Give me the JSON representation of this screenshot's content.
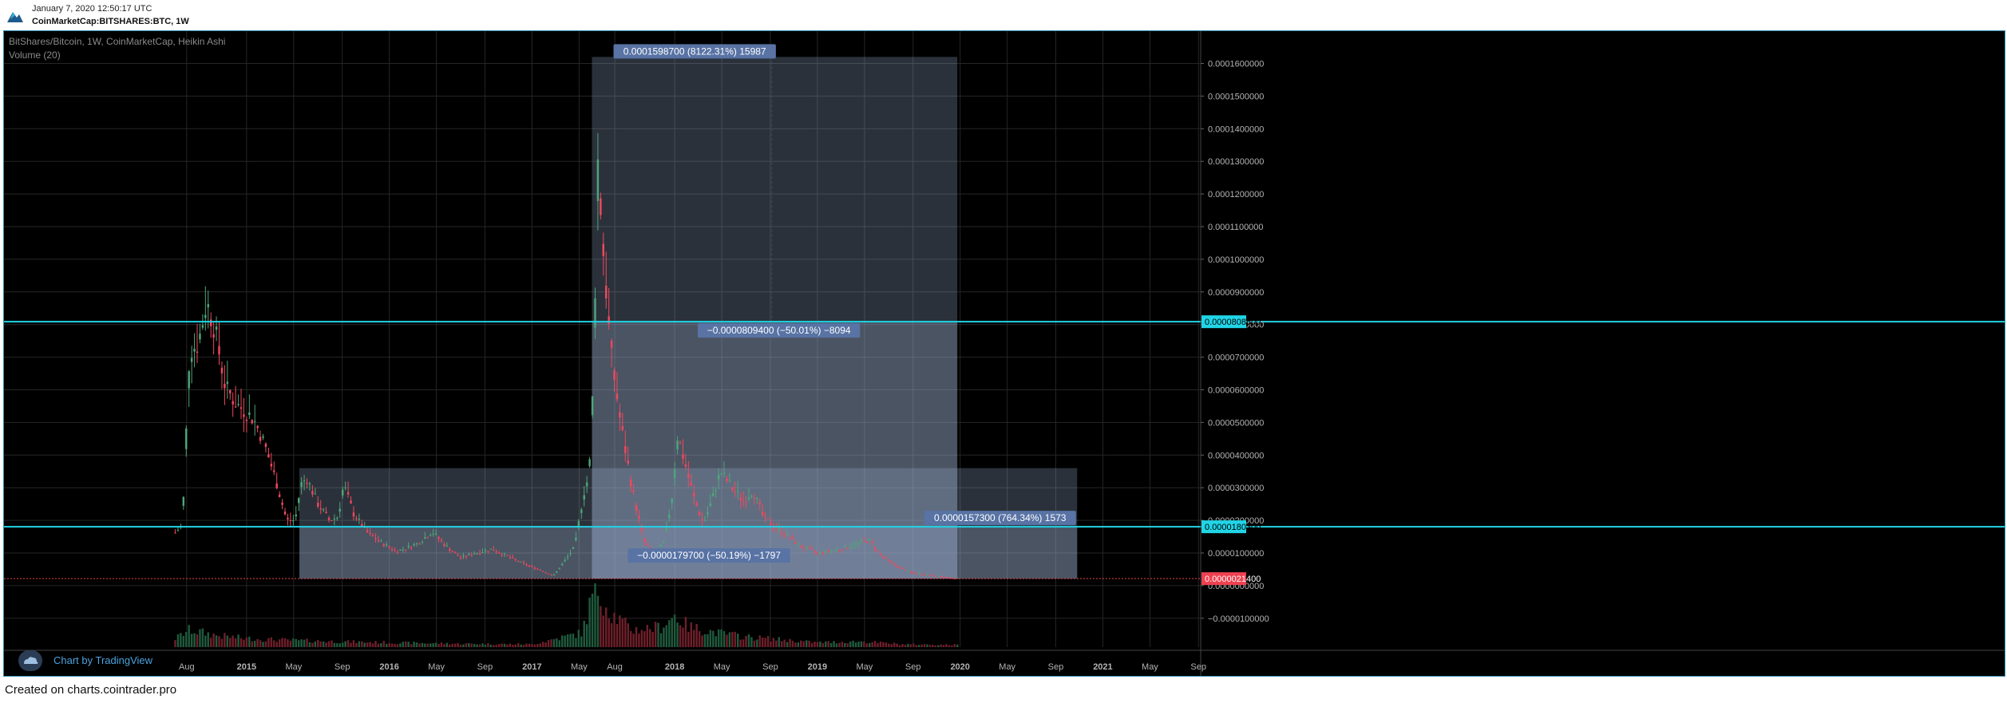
{
  "header": {
    "timestamp": "January 7, 2020 12:50:17 UTC",
    "symbol_line": "CoinMarketCap:BITSHARES:BTC, 1W"
  },
  "legend": {
    "title": "BitShares/Bitcoin, 1W, CoinMarketCap, Heikin Ashi",
    "volume": "Volume (20)"
  },
  "branding": "Chart by TradingView",
  "footer": "Created on charts.cointrader.pro",
  "colors": {
    "background": "#000000",
    "up": "#4ea67a",
    "down": "#f0485f",
    "hline": "#20d5e6",
    "box_fill": "#9cb0d0",
    "label_bg": "#5873a4",
    "last_price": "#ef4150"
  },
  "chart_data": {
    "type": "candlestick",
    "title": "BitShares/Bitcoin, 1W, CoinMarketCap, Heikin Ashi",
    "yaxis": {
      "ticks": [
        "0.0001600000",
        "0.0001500000",
        "0.0001400000",
        "0.0001300000",
        "0.0001200000",
        "0.0001100000",
        "0.0001000000",
        "0.0000900000",
        "0.0000800000",
        "0.0000700000",
        "0.0000600000",
        "0.0000500000",
        "0.0000400000",
        "0.0000300000",
        "0.0000200000",
        "0.0000100000",
        "0.0000000000",
        "−0.0000100000"
      ],
      "ylim": [
        -2.1e-05,
        0.0001665
      ]
    },
    "xaxis": {
      "ticks": [
        {
          "label": "Aug",
          "t": 2014.58
        },
        {
          "label": "2015",
          "t": 2015.0
        },
        {
          "label": "May",
          "t": 2015.33
        },
        {
          "label": "Sep",
          "t": 2015.67
        },
        {
          "label": "2016",
          "t": 2016.0
        },
        {
          "label": "May",
          "t": 2016.33
        },
        {
          "label": "Sep",
          "t": 2016.67
        },
        {
          "label": "2017",
          "t": 2017.0
        },
        {
          "label": "May",
          "t": 2017.33
        },
        {
          "label": "Aug",
          "t": 2017.58
        },
        {
          "label": "2018",
          "t": 2018.0
        },
        {
          "label": "May",
          "t": 2018.33
        },
        {
          "label": "Sep",
          "t": 2018.67
        },
        {
          "label": "2019",
          "t": 2019.0
        },
        {
          "label": "May",
          "t": 2019.33
        },
        {
          "label": "Sep",
          "t": 2019.67
        },
        {
          "label": "2020",
          "t": 2020.0
        },
        {
          "label": "May",
          "t": 2020.33
        },
        {
          "label": "Sep",
          "t": 2020.67
        },
        {
          "label": "2021",
          "t": 2021.0
        },
        {
          "label": "May",
          "t": 2021.33
        },
        {
          "label": "Sep",
          "t": 2021.67
        }
      ],
      "range": [
        2013.3,
        2021.68
      ]
    },
    "horizontal_lines": [
      {
        "price": 8.086e-05,
        "label": "0.0000808600"
      },
      {
        "price": 1.803e-05,
        "label": "0.0000180300"
      }
    ],
    "last_price": {
      "price": 2.14e-06,
      "label": "0.0000021400"
    },
    "measures": [
      {
        "t0": 2017.42,
        "t1": 2019.98,
        "p0": 2.14e-06,
        "p1": 0.000162,
        "label": "0.0001598700 (8122.31%) 15987"
      },
      {
        "t0": 2017.42,
        "t1": 2019.98,
        "p0": 2.14e-06,
        "p1": 8.086e-05,
        "label": "−0.0000809400 (−50.01%) −8094"
      },
      {
        "t0": 2015.37,
        "t1": 2020.82,
        "p0": 2.14e-06,
        "p1": 3.6e-05,
        "label": "0.0000157300 (764.34%) 1573"
      },
      {
        "t0": 2015.37,
        "t1": 2020.82,
        "p0": 2.14e-06,
        "p1": 1.803e-05,
        "label": "−0.0000179700 (−50.19%) −1797"
      }
    ],
    "series_keyframes": [
      [
        2014.5,
        1.62e-05
      ],
      [
        2014.55,
        1.85e-05
      ],
      [
        2014.6,
        7.2e-05
      ],
      [
        2014.66,
        7.4e-05
      ],
      [
        2014.72,
        8.7e-05
      ],
      [
        2014.78,
        7.8e-05
      ],
      [
        2014.85,
        6.1e-05
      ],
      [
        2014.92,
        5.6e-05
      ],
      [
        2015.0,
        5.3e-05
      ],
      [
        2015.05,
        5.1e-05
      ],
      [
        2015.12,
        4.4e-05
      ],
      [
        2015.2,
        3.3e-05
      ],
      [
        2015.28,
        2e-05
      ],
      [
        2015.34,
        2e-05
      ],
      [
        2015.38,
        3.1e-05
      ],
      [
        2015.42,
        3.3e-05
      ],
      [
        2015.5,
        2.5e-05
      ],
      [
        2015.58,
        2e-05
      ],
      [
        2015.64,
        2.1e-05
      ],
      [
        2015.68,
        3.1e-05
      ],
      [
        2015.75,
        2.2e-05
      ],
      [
        2015.85,
        1.6e-05
      ],
      [
        2015.95,
        1.3e-05
      ],
      [
        2016.05,
        1.05e-05
      ],
      [
        2016.12,
        1.15e-05
      ],
      [
        2016.2,
        1.3e-05
      ],
      [
        2016.3,
        1.65e-05
      ],
      [
        2016.4,
        1.2e-05
      ],
      [
        2016.5,
        8.5e-06
      ],
      [
        2016.6,
        1e-05
      ],
      [
        2016.72,
        1.12e-05
      ],
      [
        2016.85,
        8.5e-06
      ],
      [
        2016.95,
        6.5e-06
      ],
      [
        2017.05,
        5e-06
      ],
      [
        2017.15,
        3e-06
      ],
      [
        2017.22,
        7e-06
      ],
      [
        2017.3,
        1.2e-05
      ],
      [
        2017.36,
        2.8e-05
      ],
      [
        2017.4,
        3.4e-05
      ],
      [
        2017.43,
        6.4e-05
      ],
      [
        2017.46,
        0.000131
      ],
      [
        2017.5,
        0.000102
      ],
      [
        2017.55,
        7.2e-05
      ],
      [
        2017.62,
        5e-05
      ],
      [
        2017.7,
        3e-05
      ],
      [
        2017.78,
        1.4e-05
      ],
      [
        2017.86,
        8.5e-06
      ],
      [
        2017.93,
        1.4e-05
      ],
      [
        2017.98,
        2.7e-05
      ],
      [
        2018.02,
        4.6e-05
      ],
      [
        2018.08,
        3.6e-05
      ],
      [
        2018.14,
        2.6e-05
      ],
      [
        2018.2,
        1.9e-05
      ],
      [
        2018.26,
        2.6e-05
      ],
      [
        2018.32,
        3.5e-05
      ],
      [
        2018.4,
        3e-05
      ],
      [
        2018.48,
        2.6e-05
      ],
      [
        2018.55,
        2.9e-05
      ],
      [
        2018.62,
        2.1e-05
      ],
      [
        2018.7,
        1.8e-05
      ],
      [
        2018.8,
        1.5e-05
      ],
      [
        2018.88,
        1.2e-05
      ],
      [
        2019.0,
        1e-05
      ],
      [
        2019.15,
        1.1e-05
      ],
      [
        2019.28,
        1.28e-05
      ],
      [
        2019.36,
        1.4e-05
      ],
      [
        2019.45,
        9e-06
      ],
      [
        2019.55,
        6e-06
      ],
      [
        2019.65,
        4e-06
      ],
      [
        2019.8,
        3.2e-06
      ],
      [
        2019.92,
        2.4e-06
      ],
      [
        2019.99,
        2.2e-06
      ]
    ],
    "volume_keyframes": [
      [
        2014.5,
        0.15
      ],
      [
        2014.6,
        0.3
      ],
      [
        2014.8,
        0.2
      ],
      [
        2015.0,
        0.15
      ],
      [
        2015.3,
        0.12
      ],
      [
        2015.6,
        0.1
      ],
      [
        2016.0,
        0.08
      ],
      [
        2016.5,
        0.06
      ],
      [
        2017.0,
        0.05
      ],
      [
        2017.35,
        0.25
      ],
      [
        2017.42,
        0.85
      ],
      [
        2017.46,
        1.0
      ],
      [
        2017.55,
        0.6
      ],
      [
        2017.7,
        0.3
      ],
      [
        2017.9,
        0.35
      ],
      [
        2018.0,
        0.55
      ],
      [
        2018.1,
        0.35
      ],
      [
        2018.3,
        0.25
      ],
      [
        2018.5,
        0.18
      ],
      [
        2018.8,
        0.12
      ],
      [
        2019.0,
        0.08
      ],
      [
        2019.3,
        0.1
      ],
      [
        2019.6,
        0.05
      ],
      [
        2019.99,
        0.04
      ]
    ]
  }
}
